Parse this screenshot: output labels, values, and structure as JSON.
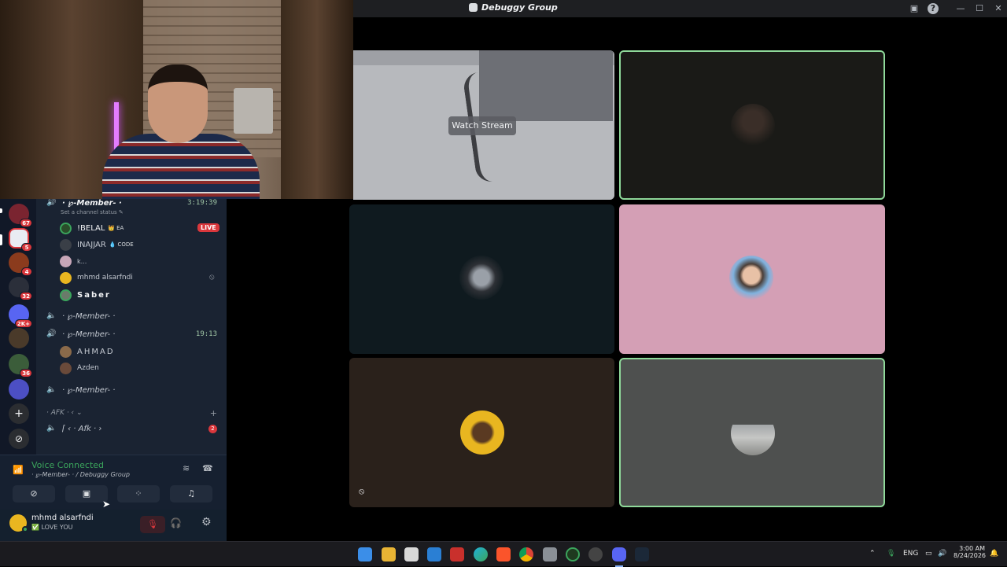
{
  "window": {
    "title": "Debuggy Group",
    "controls": {
      "minimize": "—",
      "maximize": "☐",
      "close": "✕"
    }
  },
  "stream": {
    "watch_label": "Watch Stream"
  },
  "servers": [
    {
      "badge": "67",
      "color": "#7a2430"
    },
    {
      "badge": "5",
      "color": "#e9ecf3"
    },
    {
      "badge": "4",
      "color": "#8b3b1d"
    },
    {
      "badge": "32",
      "color": "#2b2f3a"
    },
    {
      "badge": "2K+",
      "color": "#5865f2"
    },
    {
      "badge": "",
      "color": "#4a3a2a"
    },
    {
      "badge": "36",
      "color": "#3b5d3a"
    },
    {
      "badge": "",
      "color": "#4c4fc4"
    }
  ],
  "channels": {
    "ch1": {
      "name": "· ℘-Member- ·",
      "timer": "3:19:39",
      "status": "Set a channel status ✎"
    },
    "members1": [
      {
        "name": "!BELAL",
        "tag": "EA",
        "live": "LIVE"
      },
      {
        "name": "INAJJAR",
        "tag": "CODE"
      },
      {
        "name": "k..."
      },
      {
        "name": "mhmd alsarfndi"
      },
      {
        "name": "Saber"
      }
    ],
    "ch2": {
      "name": "· ℘-Member- ·"
    },
    "ch3": {
      "name": "· ℘-Member- ·",
      "timer": "19:13"
    },
    "members3": [
      {
        "name": "AHMAD"
      },
      {
        "name": "Azden"
      }
    ],
    "ch4": {
      "name": "· ℘-Member- ·"
    },
    "category": {
      "name": "· AFK · ‹ ⌄",
      "add": "+"
    },
    "afk": {
      "name": "⌈ ‹ · Afk · ›",
      "badge": "2"
    }
  },
  "voice": {
    "status": "Voice Connected",
    "sub": "· ℘-Member- · / Debuggy Group"
  },
  "user": {
    "name": "mhmd alsarfndi",
    "status": "✅ LOVE YOU"
  },
  "taskbar": {
    "lang": "ENG",
    "time": "3:00 AM",
    "date": "8/24/2026"
  }
}
